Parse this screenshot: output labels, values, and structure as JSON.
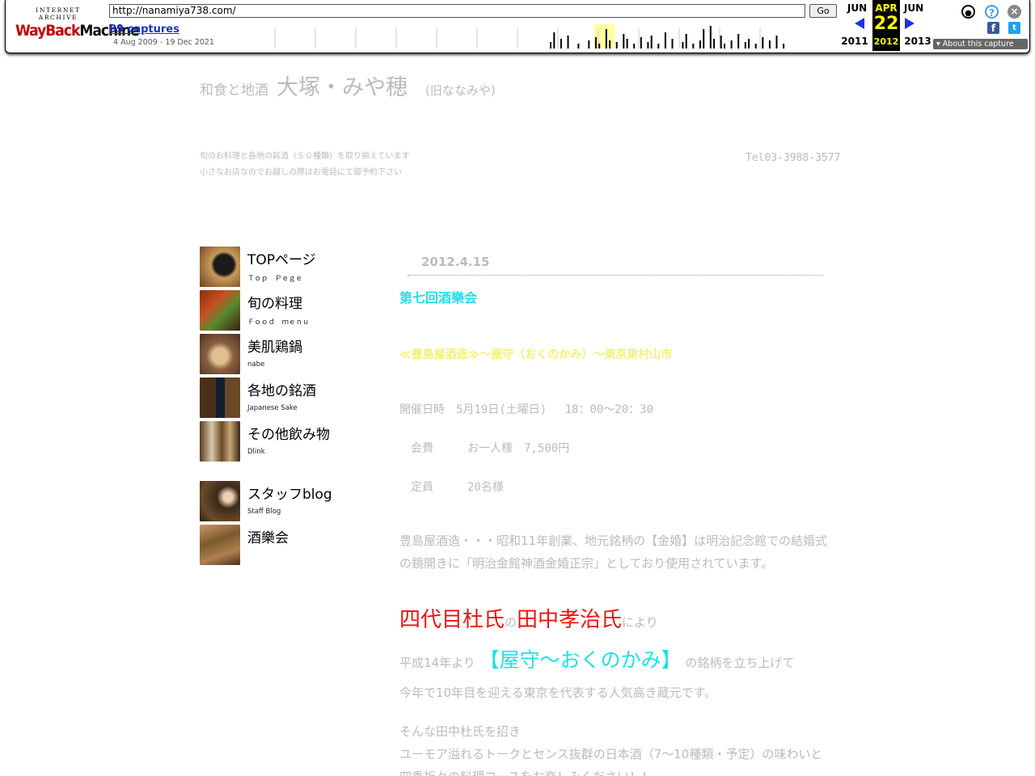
{
  "wayback": {
    "logo_top": "INTERNET ARCHIVE",
    "logo_wayback": "WayBack",
    "logo_machine": "Machine",
    "url": "http://nanamiya738.com/",
    "go_label": "Go",
    "captures": "89 captures",
    "range": "4 Aug 2009 - 19 Dec 2021",
    "prev_month": "JUN",
    "prev_year": "2011",
    "cur_month": "APR",
    "cur_day": "22",
    "cur_year": "2012",
    "next_month": "JUN",
    "next_year": "2013",
    "about_label": "About this capture",
    "icons": [
      "user-icon",
      "help-icon",
      "close-icon",
      "facebook-icon",
      "twitter-icon"
    ]
  },
  "header": {
    "title_small": "和食と地酒",
    "title_big": "大塚・みや穂",
    "title_old": "(旧ななみや)",
    "desc_line1": "旬のお料理と各地の銘酒（５０種類）を取り揃えています",
    "desc_line2": "小さなお店なのでお越しの際はお電話にて御予約下さい",
    "tel": "Tel03-3988-3577"
  },
  "nav": {
    "items": [
      {
        "label": "TOPページ",
        "sub": "Ｔｏｐ　Ｐｅｇｅ"
      },
      {
        "label": "旬の料理",
        "sub": "Ｆｏｏｄ　ｍｅｎｕ"
      },
      {
        "label": "美肌鶏鍋",
        "sub": "nabe"
      },
      {
        "label": "各地の銘酒",
        "sub": "Japanese Sake"
      },
      {
        "label": "その他飲み物",
        "sub": "Dlink"
      },
      {
        "label": "スタッフblog",
        "sub": "Staff Blog"
      },
      {
        "label": "酒樂会",
        "sub": ""
      }
    ]
  },
  "post": {
    "date": "2012.4.15",
    "title": "第七回酒樂会",
    "brewery": "≪豊島屋酒造≫～屋守（おくのかみ）～東京東村山市",
    "date_line": "開催日時　5月19日(土曜日)　 18：00～20：30",
    "fee_line": "　会費　　　お一人様　7,500円",
    "cap_line": "　定員　　　20名様",
    "para1": "豊島屋酒造・・・昭和11年創業、地元銘柄の【金婚】は明治記念館での結婚式の鏡開きに「明治金館神酒金婚正宗」としており使用されています。",
    "toji_role": "四代目杜氏",
    "toji_no": "の",
    "toji_name": "田中孝治氏",
    "toji_by": "により",
    "brand_pre": "平成14年より",
    "brand_name": "【屋守～おくのかみ】",
    "brand_post": "の銘柄を立ち上げて",
    "para3": "今年で10年目を迎える東京を代表する人気高き蔵元です。",
    "para4_1": "そんな田中杜氏を招き",
    "para4_2": "ユーモア溢れるトークとセンス抜群の日本酒（7～10種類・予定）の味わいと四季折々の料理コースをお楽しみください！！"
  },
  "colors": {
    "accent_cyan": "#1ee0e6",
    "accent_red": "#ee1111",
    "accent_yellow": "#f1f17a",
    "wayback_red": "#c20000",
    "current_highlight": "#ffff00"
  }
}
